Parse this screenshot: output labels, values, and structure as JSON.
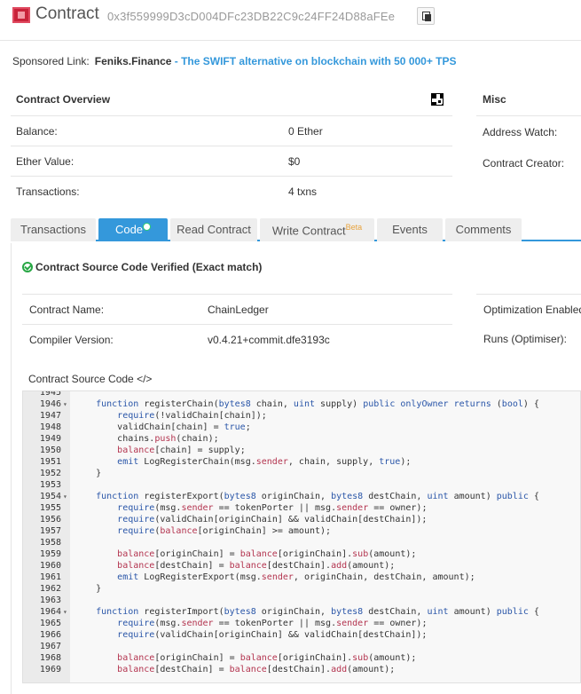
{
  "header": {
    "title": "Contract",
    "address": "0x3f559999D3cD004DFc23DB22C9c24FF24D88aFEe"
  },
  "sponsor": {
    "label": "Sponsored Link:",
    "name": "Feniks.Finance",
    "text": " - The SWIFT alternative on blockchain with 50 000+ TPS"
  },
  "overview": {
    "title": "Contract Overview",
    "rows": [
      {
        "label": "Balance:",
        "value": "0 Ether"
      },
      {
        "label": "Ether Value:",
        "value": "$0"
      },
      {
        "label": "Transactions:",
        "value": "4 txns"
      }
    ]
  },
  "misc": {
    "title": "Misc",
    "rows": [
      {
        "label": "Address Watch:"
      },
      {
        "label": "Contract Creator:"
      }
    ]
  },
  "tabs": [
    {
      "label": "Transactions"
    },
    {
      "label": "Code"
    },
    {
      "label": "Read Contract"
    },
    {
      "label": "Write Contract",
      "badge": "Beta"
    },
    {
      "label": "Events"
    },
    {
      "label": "Comments"
    }
  ],
  "verified": {
    "text": "Contract Source Code Verified (Exact match)"
  },
  "info": {
    "rows": [
      {
        "label": "Contract Name:",
        "value": "ChainLedger"
      },
      {
        "label": "Compiler Version:",
        "value": "v0.4.21+commit.dfe3193c"
      }
    ],
    "right": [
      {
        "label": "Optimization Enabled"
      },
      {
        "label": "Runs (Optimiser):"
      }
    ]
  },
  "source": {
    "label": "Contract Source Code </>",
    "lines": [
      {
        "n": "1945",
        "fold": false,
        "t": ""
      },
      {
        "n": "1946",
        "fold": true,
        "t": "    function registerChain(bytes8 chain, uint supply) public onlyOwner returns (bool) {"
      },
      {
        "n": "1947",
        "fold": false,
        "t": "        require(!validChain[chain]);"
      },
      {
        "n": "1948",
        "fold": false,
        "t": "        validChain[chain] = true;"
      },
      {
        "n": "1949",
        "fold": false,
        "t": "        chains.push(chain);"
      },
      {
        "n": "1950",
        "fold": false,
        "t": "        balance[chain] = supply;"
      },
      {
        "n": "1951",
        "fold": false,
        "t": "        emit LogRegisterChain(msg.sender, chain, supply, true);"
      },
      {
        "n": "1952",
        "fold": false,
        "t": "    }"
      },
      {
        "n": "1953",
        "fold": false,
        "t": ""
      },
      {
        "n": "1954",
        "fold": true,
        "t": "    function registerExport(bytes8 originChain, bytes8 destChain, uint amount) public {"
      },
      {
        "n": "1955",
        "fold": false,
        "t": "        require(msg.sender == tokenPorter || msg.sender == owner);"
      },
      {
        "n": "1956",
        "fold": false,
        "t": "        require(validChain[originChain] && validChain[destChain]);"
      },
      {
        "n": "1957",
        "fold": false,
        "t": "        require(balance[originChain] >= amount);"
      },
      {
        "n": "1958",
        "fold": false,
        "t": ""
      },
      {
        "n": "1959",
        "fold": false,
        "t": "        balance[originChain] = balance[originChain].sub(amount);"
      },
      {
        "n": "1960",
        "fold": false,
        "t": "        balance[destChain] = balance[destChain].add(amount);"
      },
      {
        "n": "1961",
        "fold": false,
        "t": "        emit LogRegisterExport(msg.sender, originChain, destChain, amount);"
      },
      {
        "n": "1962",
        "fold": false,
        "t": "    }"
      },
      {
        "n": "1963",
        "fold": false,
        "t": ""
      },
      {
        "n": "1964",
        "fold": true,
        "t": "    function registerImport(bytes8 originChain, bytes8 destChain, uint amount) public {"
      },
      {
        "n": "1965",
        "fold": false,
        "t": "        require(msg.sender == tokenPorter || msg.sender == owner);"
      },
      {
        "n": "1966",
        "fold": false,
        "t": "        require(validChain[originChain] && validChain[destChain]);"
      },
      {
        "n": "1967",
        "fold": false,
        "t": ""
      },
      {
        "n": "1968",
        "fold": false,
        "t": "        balance[originChain] = balance[originChain].sub(amount);"
      },
      {
        "n": "1969",
        "fold": false,
        "t": "        balance[destChain] = balance[destChain].add(amount);"
      }
    ]
  },
  "colors": {
    "accent": "#3498db",
    "verified": "#28a745",
    "beta": "#e8a33d"
  }
}
